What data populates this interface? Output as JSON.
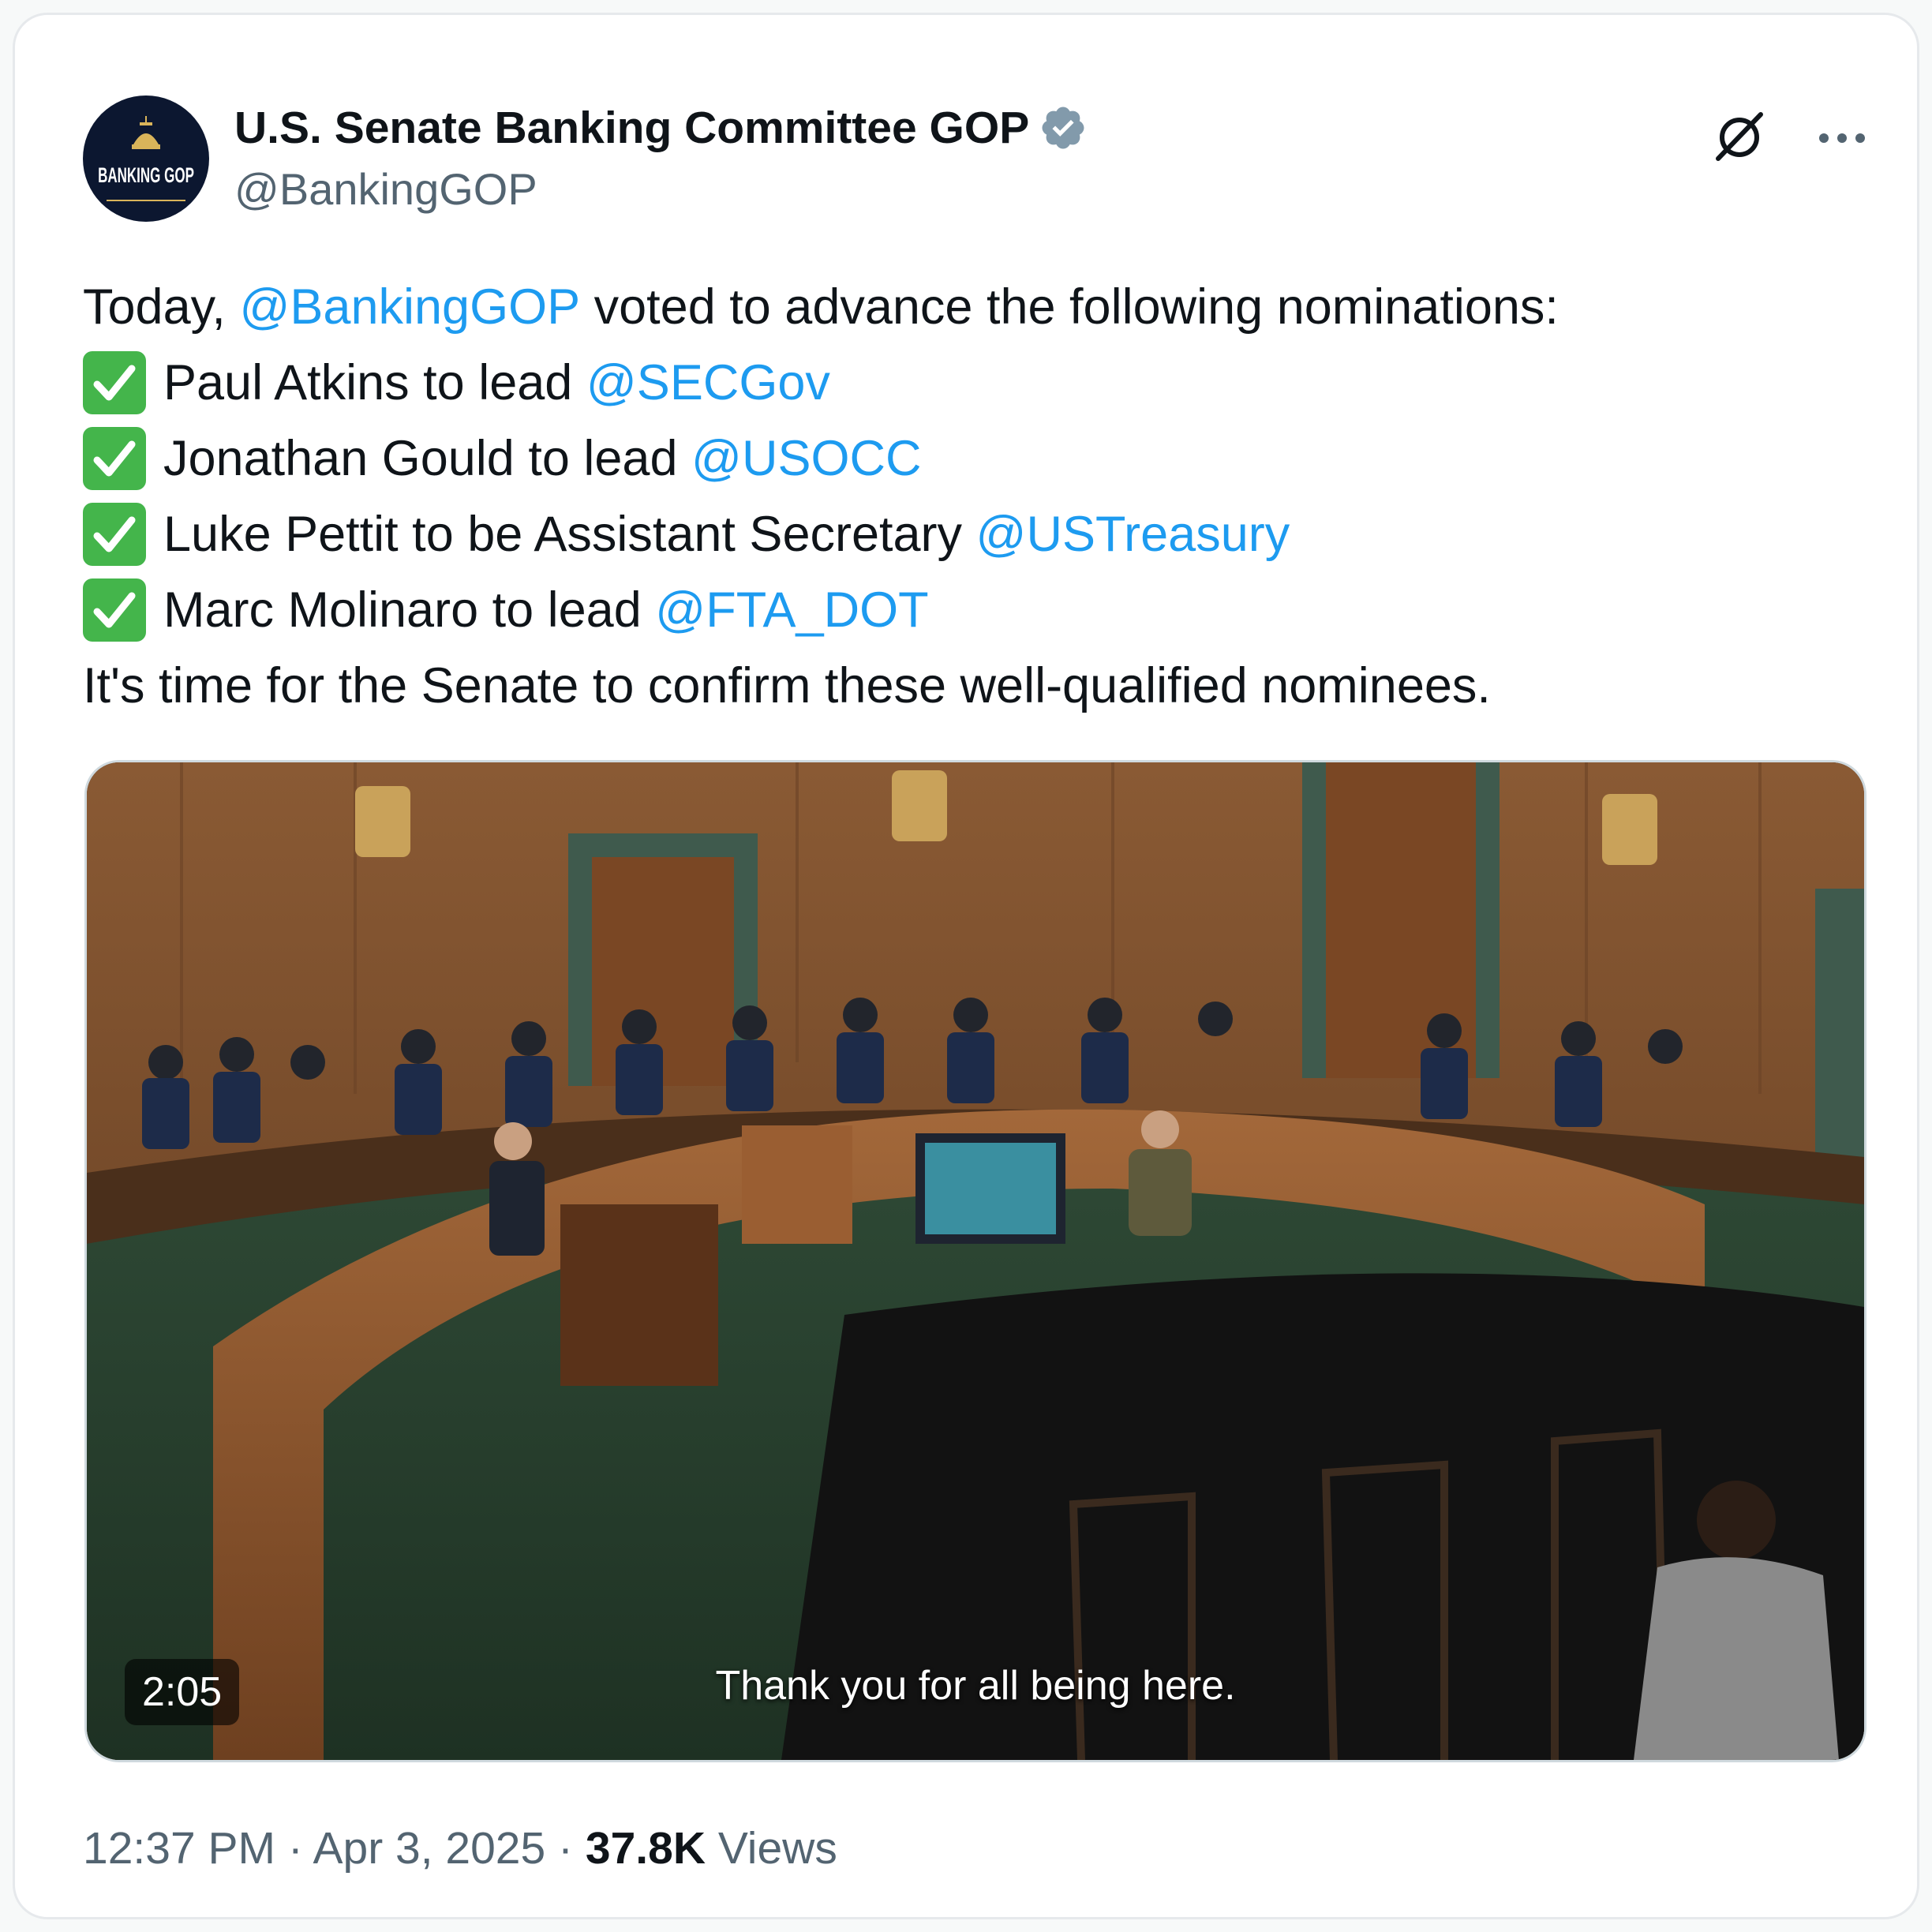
{
  "author": {
    "display_name": "U.S. Senate Banking Committee GOP",
    "handle": "@BankingGOP",
    "avatar_text": "BANKING GOP",
    "verified_icon": "verified-badge-icon",
    "verified_color": "#829aab"
  },
  "tweet": {
    "line1_prefix": "Today, ",
    "line1_mention": "@BankingGOP",
    "line1_suffix": " voted to advance the following nominations:",
    "items": [
      {
        "text": "Paul Atkins to lead ",
        "mention": "@SECGov"
      },
      {
        "text": "Jonathan Gould to lead ",
        "mention": "@USOCC"
      },
      {
        "text": "Luke Pettit to be Assistant Secretary ",
        "mention": "@USTreasury"
      },
      {
        "text": "Marc Molinaro to lead ",
        "mention": "@FTA_DOT"
      }
    ],
    "closing": "It's time for the Senate to confirm these well-qualified nominees."
  },
  "media": {
    "duration": "2:05",
    "caption": "Thank you for all being here."
  },
  "meta": {
    "time": "12:37 PM",
    "separator": " · ",
    "date": "Apr 3, 2025",
    "views_count": "37.8K",
    "views_label": " Views"
  },
  "colors": {
    "mention": "#1d9bf0",
    "text": "#0f1419",
    "secondary": "#536471",
    "check": "#44b54b"
  }
}
